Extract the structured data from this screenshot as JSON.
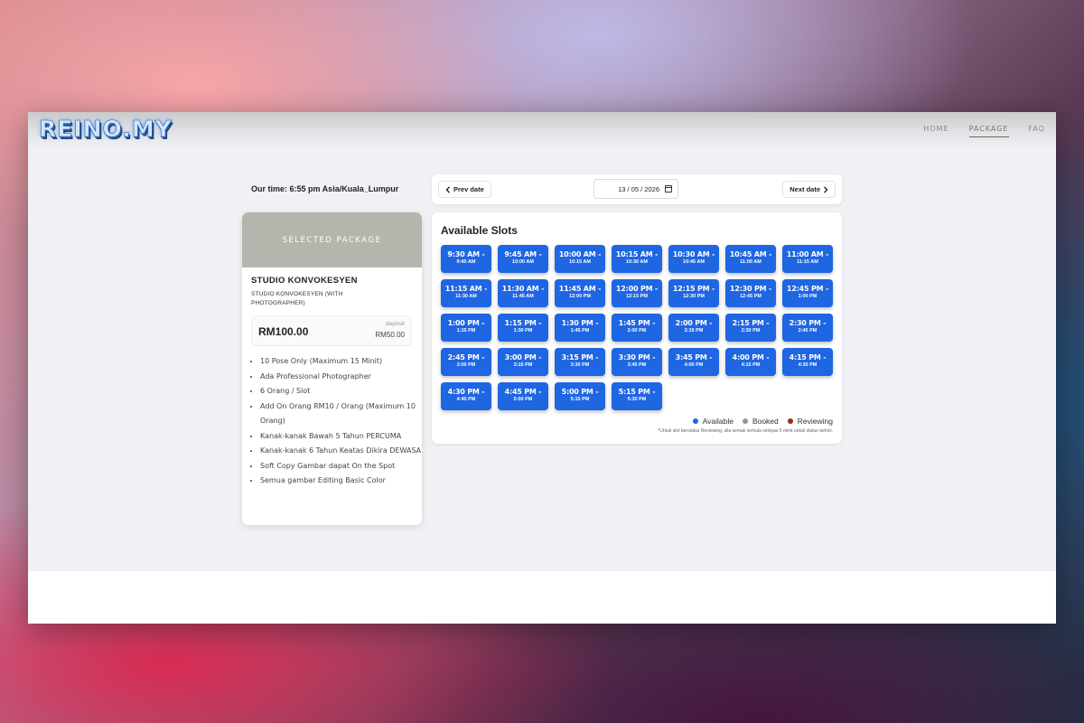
{
  "brand": {
    "logo": "REINO.MY"
  },
  "nav": {
    "items": [
      "HOME",
      "PACKAGE",
      "FAQ"
    ],
    "active": "PACKAGE"
  },
  "time": {
    "label": "Our time: 6:55 pm Asia/Kuala_Lumpur"
  },
  "date_nav": {
    "prev_label": "Prev date",
    "next_label": "Next date",
    "date_value": "13 / 05 / 2026"
  },
  "package": {
    "header": "SELECTED PACKAGE",
    "name": "STUDIO KONVOKESYEN",
    "subtitle": "STUDIO KONVOKESYEN (WITH PHOTOGRAPHER)",
    "price": "RM100.00",
    "deposit_label": "deposit",
    "deposit_value": "RM50.00",
    "features": [
      "10 Pose Only (Maximum 15 Minit)",
      "Ada Professional Photographer",
      "6 Orang / Slot",
      "Add On Orang RM10 / Orang (Maximum 10 Orang)",
      "Kanak-kanak Bawah 5 Tahun PERCUMA",
      "Kanak-kanak 6 Tahun Keatas Dikira DEWASA",
      "Soft Copy Gambar dapat On the Spot",
      "Semua gambar Editing Basic Color"
    ]
  },
  "slots": {
    "title": "Available Slots",
    "items": [
      {
        "start": "9:30 AM -",
        "end": "9:45 AM"
      },
      {
        "start": "9:45 AM -",
        "end": "10:00 AM"
      },
      {
        "start": "10:00 AM -",
        "end": "10:15 AM"
      },
      {
        "start": "10:15 AM -",
        "end": "10:30 AM"
      },
      {
        "start": "10:30 AM -",
        "end": "10:45 AM"
      },
      {
        "start": "10:45 AM -",
        "end": "11:00 AM"
      },
      {
        "start": "11:00 AM -",
        "end": "11:15 AM"
      },
      {
        "start": "11:15 AM -",
        "end": "11:30 AM"
      },
      {
        "start": "11:30 AM -",
        "end": "11:45 AM"
      },
      {
        "start": "11:45 AM -",
        "end": "12:00 PM"
      },
      {
        "start": "12:00 PM -",
        "end": "12:15 PM"
      },
      {
        "start": "12:15 PM -",
        "end": "12:30 PM"
      },
      {
        "start": "12:30 PM -",
        "end": "12:45 PM"
      },
      {
        "start": "12:45 PM -",
        "end": "1:00 PM"
      },
      {
        "start": "1:00 PM -",
        "end": "1:15 PM"
      },
      {
        "start": "1:15 PM -",
        "end": "1:30 PM"
      },
      {
        "start": "1:30 PM -",
        "end": "1:45 PM"
      },
      {
        "start": "1:45 PM -",
        "end": "2:00 PM"
      },
      {
        "start": "2:00 PM -",
        "end": "2:15 PM"
      },
      {
        "start": "2:15 PM -",
        "end": "2:30 PM"
      },
      {
        "start": "2:30 PM -",
        "end": "2:45 PM"
      },
      {
        "start": "2:45 PM -",
        "end": "3:00 PM"
      },
      {
        "start": "3:00 PM -",
        "end": "3:15 PM"
      },
      {
        "start": "3:15 PM -",
        "end": "3:30 PM"
      },
      {
        "start": "3:30 PM -",
        "end": "3:45 PM"
      },
      {
        "start": "3:45 PM -",
        "end": "4:00 PM"
      },
      {
        "start": "4:00 PM -",
        "end": "4:15 PM"
      },
      {
        "start": "4:15 PM -",
        "end": "4:30 PM"
      },
      {
        "start": "4:30 PM -",
        "end": "4:45 PM"
      },
      {
        "start": "4:45 PM -",
        "end": "5:00 PM"
      },
      {
        "start": "5:00 PM -",
        "end": "5:15 PM"
      },
      {
        "start": "5:15 PM -",
        "end": "5:30 PM"
      }
    ]
  },
  "legend": {
    "available": "Available",
    "booked": "Booked",
    "reviewing": "Reviewing",
    "note": "*Untuk slot berstatus Reviewing, sila semak semula selepas 5 minit untuk status terkini."
  },
  "colors": {
    "slot_available": "#1f66e3",
    "legend_available": "#1f66e3",
    "legend_booked": "#8d97a6",
    "legend_reviewing": "#9a2b14",
    "package_header": "#b5b5ad"
  },
  "icons": {
    "prev": "chevron-left-icon",
    "next": "chevron-right-icon",
    "calendar": "calendar-icon"
  }
}
